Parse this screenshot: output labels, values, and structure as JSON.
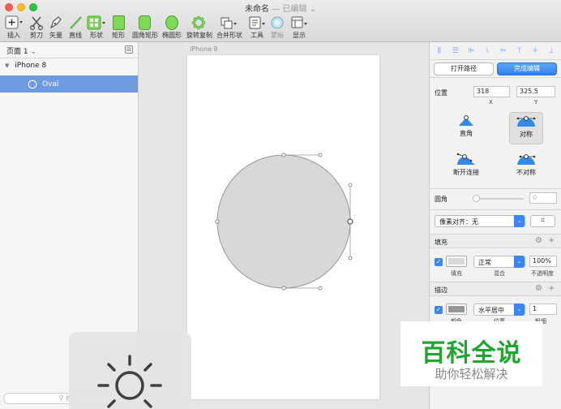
{
  "window": {
    "title": "未命名",
    "status": " — 已编辑",
    "status_chevron": "⌄"
  },
  "toolbar": [
    {
      "name": "insert",
      "label": "插入"
    },
    {
      "name": "scissors",
      "label": "剪刀"
    },
    {
      "name": "vector",
      "label": "矢量"
    },
    {
      "name": "line",
      "label": "直线"
    },
    {
      "name": "shape",
      "label": "形状"
    },
    {
      "name": "rectangle",
      "label": "矩形"
    },
    {
      "name": "rounded-rect",
      "label": "圆角矩形"
    },
    {
      "name": "oval",
      "label": "椭圆形"
    },
    {
      "name": "rotate-copy",
      "label": "旋转复制"
    },
    {
      "name": "combine",
      "label": "合并形状"
    },
    {
      "name": "tools",
      "label": "工具"
    },
    {
      "name": "mask",
      "label": "蒙板"
    },
    {
      "name": "display",
      "label": "显示"
    }
  ],
  "sidebar": {
    "page_selector": "页面 1",
    "artboard": "iPhone 8",
    "layer": "Oval",
    "search_placeholder": "搜索"
  },
  "canvas": {
    "artboard_label": "iPhone 8"
  },
  "inspector": {
    "open_path": "打开路径",
    "finish_edit": "完成编辑",
    "position_label": "位置",
    "x_value": "318",
    "x_label": "X",
    "y_value": "325.5",
    "y_label": "Y",
    "point_types": [
      {
        "name": "straight",
        "label": "直角"
      },
      {
        "name": "mirrored",
        "label": "对称"
      },
      {
        "name": "disconnected",
        "label": "断开连接"
      },
      {
        "name": "asymmetric",
        "label": "不对称"
      }
    ],
    "corner_label": "圆角",
    "corner_value": "0",
    "pixel_align": "像素对齐：无",
    "fill": {
      "title": "填充",
      "swatch_color": "#d8d8d8",
      "swatch_label": "填充",
      "blend": "正常",
      "blend_label": "混合",
      "opacity": "100%",
      "opacity_label": "不透明度"
    },
    "border": {
      "title": "描边",
      "swatch_color": "#979797",
      "swatch_label": "颜色",
      "position": "水平居中",
      "position_label": "位置",
      "width": "1",
      "width_label": "粗细"
    }
  },
  "watermark": {
    "title": "百科全说",
    "subtitle": "助你轻松解决"
  },
  "colors": {
    "accent": "#3b86f0",
    "selection": "#6e9ae0",
    "shape_fill": "#d8d8d8",
    "shape_stroke": "#979797",
    "brand_green": "#1fa62e"
  }
}
